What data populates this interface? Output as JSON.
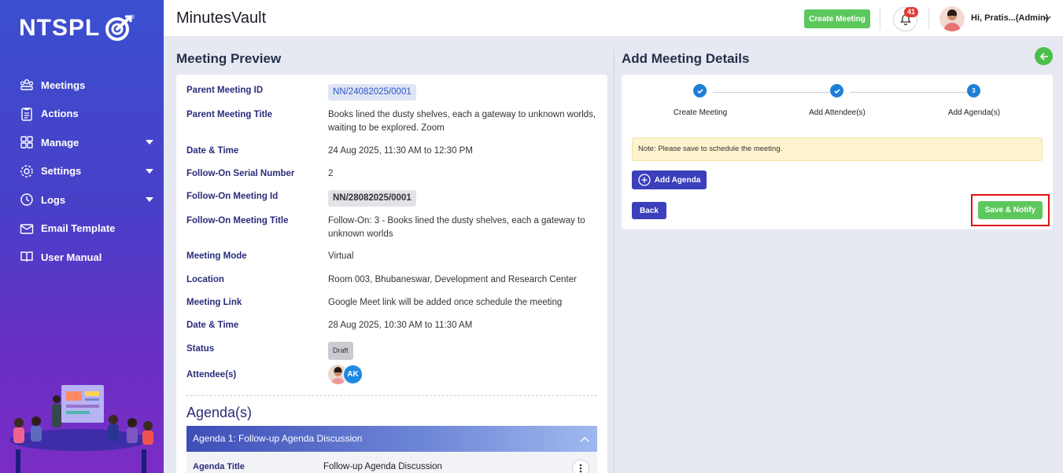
{
  "brand": {
    "logo_text": "NTSPL",
    "registered": "®"
  },
  "sidebar": {
    "items": [
      {
        "label": "Meetings",
        "icon": "meetings-icon",
        "has_caret": false
      },
      {
        "label": "Actions",
        "icon": "actions-icon",
        "has_caret": false
      },
      {
        "label": "Manage",
        "icon": "manage-icon",
        "has_caret": true
      },
      {
        "label": "Settings",
        "icon": "gear-icon",
        "has_caret": true
      },
      {
        "label": "Logs",
        "icon": "history-icon",
        "has_caret": true
      },
      {
        "label": "Email Template",
        "icon": "email-icon",
        "has_caret": false
      },
      {
        "label": "User Manual",
        "icon": "book-icon",
        "has_caret": false
      }
    ]
  },
  "header": {
    "app_title": "MinutesVault",
    "create_meeting_label": "Create Meeting",
    "notification_count": "41",
    "user_greeting": "Hi, Pratis...(Admin)"
  },
  "preview": {
    "title": "Meeting Preview",
    "fields": {
      "parent_id_label": "Parent Meeting ID",
      "parent_id_value": "NN/24082025/0001",
      "parent_title_label": "Parent Meeting Title",
      "parent_title_value": "Books lined the dusty shelves, each a gateway to unknown worlds, waiting to be explored. Zoom",
      "datetime1_label": "Date & Time",
      "datetime1_value": "24 Aug 2025, 11:30 AM to 12:30 PM",
      "serial_label": "Follow-On Serial Number",
      "serial_value": "2",
      "followon_id_label": "Follow-On Meeting Id",
      "followon_id_value": "NN/28082025/0001",
      "followon_title_label": "Follow-On Meeting Title",
      "followon_title_value": "Follow-On: 3 - Books lined the dusty shelves, each a gateway to unknown worlds",
      "mode_label": "Meeting Mode",
      "mode_value": "Virtual",
      "location_label": "Location",
      "location_value": "Room 003, Bhubaneswar, Development and Research Center",
      "link_label": "Meeting Link",
      "link_value": "Google Meet link will be added once schedule the meeting",
      "datetime2_label": "Date & Time",
      "datetime2_value": "28 Aug 2025, 10:30 AM to 11:30 AM",
      "status_label": "Status",
      "status_value": "Draft",
      "attendees_label": "Attendee(s)",
      "attendee_initials": "AK"
    },
    "agenda_heading": "Agenda(s)",
    "agenda_item_title": "Agenda 1: Follow-up Agenda Discussion",
    "agenda_title_label": "Agenda Title",
    "agenda_title_value": "Follow-up Agenda Discussion"
  },
  "details": {
    "title": "Add Meeting Details",
    "steps": [
      {
        "label": "Create Meeting",
        "state": "done"
      },
      {
        "label": "Add Attendee(s)",
        "state": "done"
      },
      {
        "label": "Add Agenda(s)",
        "state": "current",
        "number": "3"
      }
    ],
    "note": "Note: Please save to schedule the meeting.",
    "add_agenda_label": "Add Agenda",
    "back_label": "Back",
    "save_notify_label": "Save & Notify"
  },
  "colors": {
    "accent": "#3b3fbb",
    "success": "#5cc85c",
    "step_blue": "#1e7fd8",
    "highlight": "#e01010"
  }
}
